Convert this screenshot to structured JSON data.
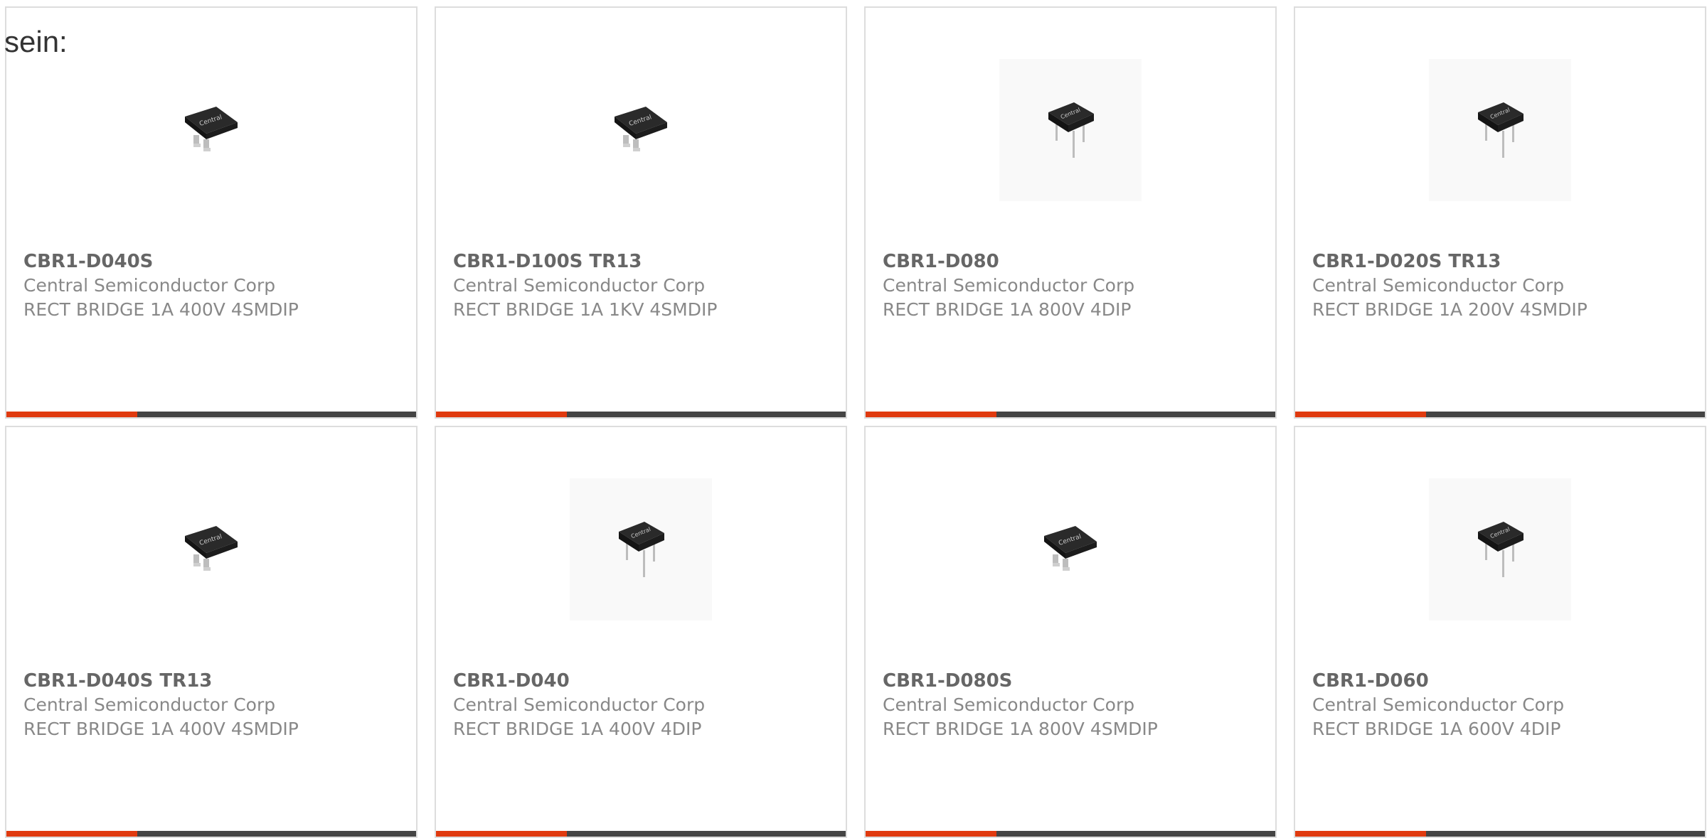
{
  "intro_text": "sein:",
  "colors": {
    "accent": "#e03a0f",
    "bar": "#444444",
    "border": "#dddddd"
  },
  "products": [
    {
      "part": "CBR1-D040S",
      "manufacturer": "Central Semiconductor Corp",
      "description": "RECT BRIDGE 1A 400V 4SMDIP",
      "icon": "smd-bridge-icon"
    },
    {
      "part": "CBR1-D100S TR13",
      "manufacturer": "Central Semiconductor Corp",
      "description": "RECT BRIDGE 1A 1KV 4SMDIP",
      "icon": "smd-bridge-icon"
    },
    {
      "part": "CBR1-D080",
      "manufacturer": "Central Semiconductor Corp",
      "description": "RECT BRIDGE 1A 800V 4DIP",
      "icon": "dip-bridge-icon"
    },
    {
      "part": "CBR1-D020S TR13",
      "manufacturer": "Central Semiconductor Corp",
      "description": "RECT BRIDGE 1A 200V 4SMDIP",
      "icon": "dip-bridge-icon"
    },
    {
      "part": "CBR1-D040S TR13",
      "manufacturer": "Central Semiconductor Corp",
      "description": "RECT BRIDGE 1A 400V 4SMDIP",
      "icon": "smd-bridge-icon"
    },
    {
      "part": "CBR1-D040",
      "manufacturer": "Central Semiconductor Corp",
      "description": "RECT BRIDGE 1A 400V 4DIP",
      "icon": "dip-bridge-icon"
    },
    {
      "part": "CBR1-D080S",
      "manufacturer": "Central Semiconductor Corp",
      "description": "RECT BRIDGE 1A 800V 4SMDIP",
      "icon": "smd-bridge-icon"
    },
    {
      "part": "CBR1-D060",
      "manufacturer": "Central Semiconductor Corp",
      "description": "RECT BRIDGE 1A 600V 4DIP",
      "icon": "dip-bridge-icon"
    }
  ]
}
